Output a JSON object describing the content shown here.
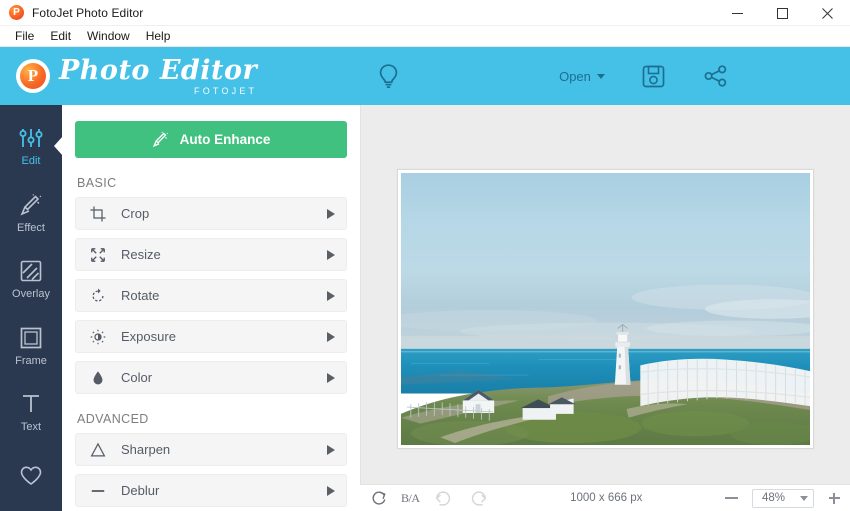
{
  "window": {
    "title": "FotoJet Photo Editor",
    "app_icon": "fotojet-p-icon",
    "controls": {
      "minimize": "minimize-icon",
      "maximize": "maximize-icon",
      "close": "close-icon"
    }
  },
  "menubar": {
    "items": [
      {
        "label": "File"
      },
      {
        "label": "Edit"
      },
      {
        "label": "Window"
      },
      {
        "label": "Help"
      }
    ]
  },
  "header": {
    "brand": {
      "mark_letter": "P",
      "title": "Photo Editor",
      "subtitle": "FOTOJET"
    },
    "background_color": "#45c1e8",
    "tools": [
      {
        "name": "tips-lightbulb-icon",
        "icon": "lightbulb-icon",
        "label": ""
      },
      {
        "name": "open-button",
        "icon": "chevron-down-icon",
        "label": "Open"
      },
      {
        "name": "save-button",
        "icon": "floppy-disk-icon",
        "label": ""
      },
      {
        "name": "share-button",
        "icon": "share-nodes-icon",
        "label": ""
      }
    ]
  },
  "sidebar": {
    "active": "Edit",
    "accent_color": "#45c1e8",
    "background_color": "#2b3950",
    "items": [
      {
        "label": "Edit",
        "icon": "sliders-icon"
      },
      {
        "label": "Effect",
        "icon": "magic-wand-icon"
      },
      {
        "label": "Overlay",
        "icon": "hatched-square-icon"
      },
      {
        "label": "Frame",
        "icon": "frame-square-icon"
      },
      {
        "label": "Text",
        "icon": "text-t-icon"
      },
      {
        "label": "",
        "icon": "heart-icon"
      }
    ]
  },
  "toolpanel": {
    "auto_enhance": {
      "label": "Auto Enhance",
      "icon": "magic-wand-icon",
      "color": "#41c180"
    },
    "sections": [
      {
        "label": "BASIC",
        "rows": [
          {
            "label": "Crop",
            "icon": "crop-icon"
          },
          {
            "label": "Resize",
            "icon": "resize-arrows-icon"
          },
          {
            "label": "Rotate",
            "icon": "rotate-icon"
          },
          {
            "label": "Exposure",
            "icon": "brightness-sun-icon"
          },
          {
            "label": "Color",
            "icon": "droplet-icon"
          }
        ]
      },
      {
        "label": "ADVANCED",
        "rows": [
          {
            "label": "Sharpen",
            "icon": "triangle-icon"
          },
          {
            "label": "Deblur",
            "icon": "minus-bar-icon"
          }
        ]
      }
    ]
  },
  "canvas": {
    "image_alt": "lighthouse-on-coastal-cliff-photo",
    "background_color": "#ececec"
  },
  "bottombar": {
    "reset": {
      "name": "reset-icon",
      "label": ""
    },
    "compare": {
      "name": "before-after-toggle",
      "label": "B/A"
    },
    "undo": {
      "name": "undo-icon",
      "label": ""
    },
    "redo": {
      "name": "redo-icon",
      "label": ""
    },
    "dimensions": "1000 x 666 px",
    "zoom_out": "zoom-out-icon",
    "zoom_value": "48%",
    "zoom_in": "zoom-in-icon"
  }
}
